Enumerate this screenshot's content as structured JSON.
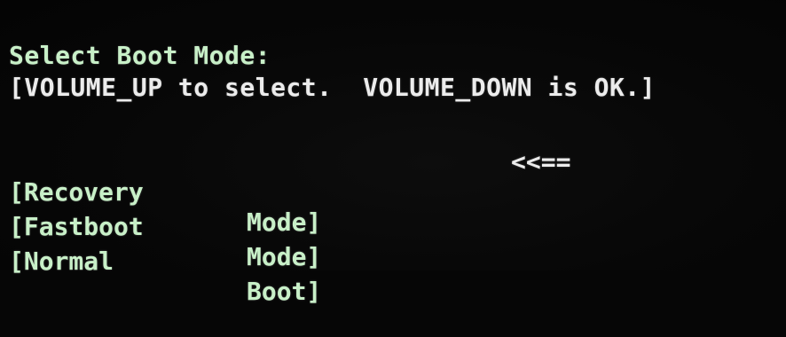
{
  "boot_menu": {
    "title": "Select Boot Mode:",
    "hint": "[VOLUME_UP to select.  VOLUME_DOWN is OK.]",
    "items": [
      {
        "label": "[Recovery",
        "suffix": "Mode]",
        "selected": true
      },
      {
        "label": "[Fastboot",
        "suffix": "Mode]",
        "selected": false
      },
      {
        "label": "[Normal",
        "suffix": "Boot]",
        "selected": false
      }
    ],
    "selector": "<<=="
  },
  "colors": {
    "background": "#060606",
    "title_text": "#c8f0c8",
    "body_text": "#ececec"
  }
}
